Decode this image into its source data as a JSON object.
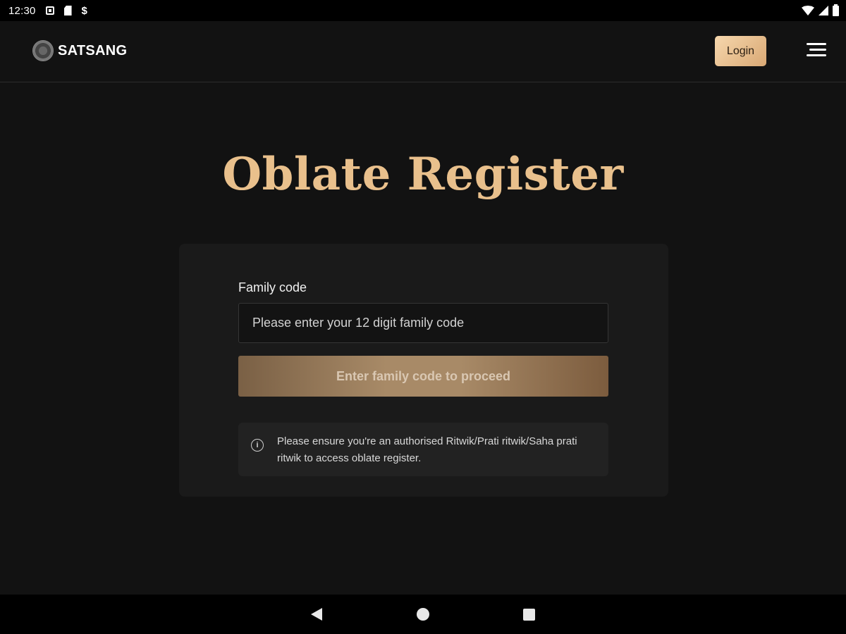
{
  "status_bar": {
    "time": "12:30",
    "left_icons": [
      "photo-icon",
      "sd-card-icon",
      "dollar-icon"
    ],
    "dollar_glyph": "$",
    "right_icons": [
      "wifi-icon",
      "signal-icon",
      "battery-icon"
    ]
  },
  "header": {
    "brand": "SATSANG",
    "login_label": "Login",
    "menu_icon": "hamburger-menu-icon"
  },
  "page": {
    "title": "Oblate Register"
  },
  "form": {
    "family_code_label": "Family code",
    "family_code_value": "",
    "family_code_placeholder": "Please enter your 12 digit family code",
    "proceed_label": "Enter family code to proceed",
    "notice_icon_glyph": "i",
    "notice_text": "Please ensure you're an authorised Ritwik/Prati ritwik/Saha prati ritwik to access oblate register."
  },
  "colors": {
    "background": "#121212",
    "accent_gold": "#e9c08c",
    "login_button": "#e8c194",
    "card": "#1a1a1a"
  },
  "nav_bar": {
    "buttons": [
      "back-icon",
      "home-icon",
      "recents-icon"
    ]
  }
}
